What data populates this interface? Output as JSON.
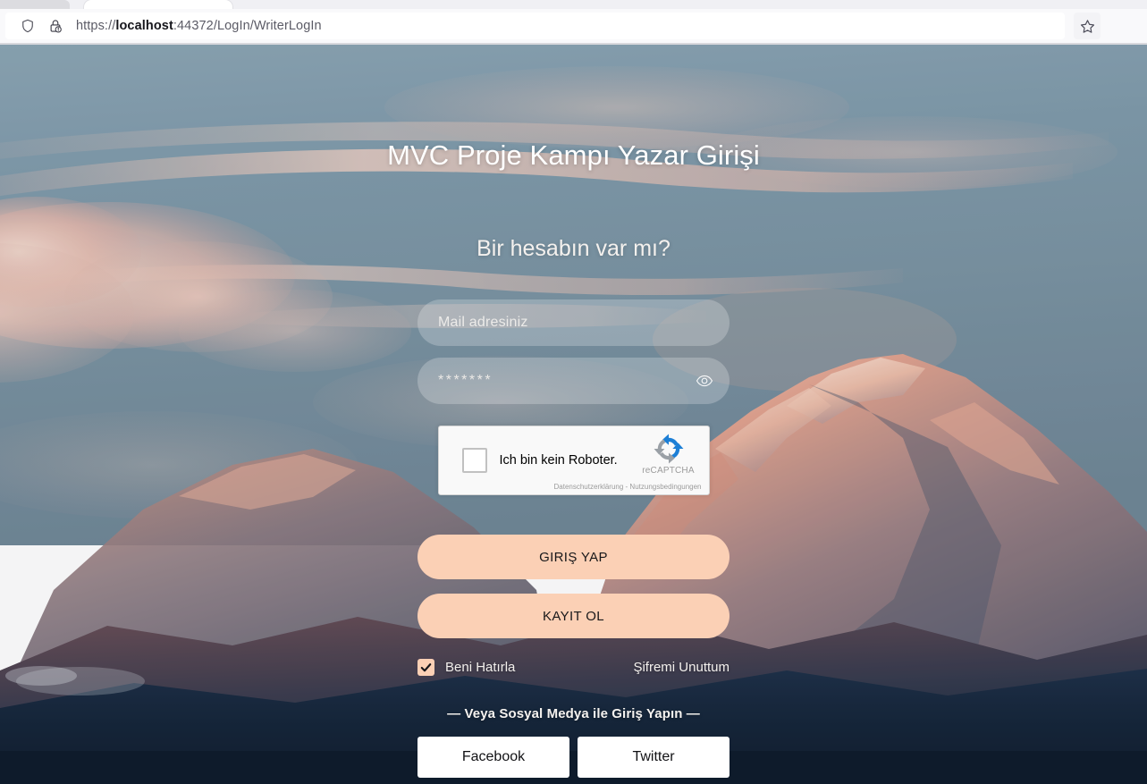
{
  "browser": {
    "url_prefix": "https://",
    "url_host": "localhost",
    "url_rest": ":44372/LogIn/WriterLogIn",
    "full_url": "https://localhost:44372/LogIn/WriterLogIn",
    "shield_icon": "shield-icon",
    "lock_icon": "lock-warning-icon",
    "bookmark_icon": "bookmark-star-icon"
  },
  "login": {
    "title": "MVC Proje Kampı Yazar Girişi",
    "subtitle": "Bir hesabın var mı?",
    "email_placeholder": "Mail adresiniz",
    "password_value": "*******",
    "password_toggle_icon": "eye-icon",
    "login_button": "GIRIŞ YAP",
    "register_button": "KAYIT OL",
    "remember_label": "Beni Hatırla",
    "remember_checked": true,
    "remember_check_glyph": "✔",
    "forgot_password": "Şifremi Unuttum",
    "social_divider": "— Veya Sosyal Medya ile Giriş Yapın —",
    "social_buttons": [
      {
        "label": "Facebook",
        "name": "facebook-login-button"
      },
      {
        "label": "Twitter",
        "name": "twitter-login-button"
      }
    ]
  },
  "recaptcha": {
    "label": "Ich bin kein Roboter.",
    "brand": "reCAPTCHA",
    "legal": "Datenschutzerklärung - Nutzungsbedingungen",
    "logo_icon": "recaptcha-logo-icon",
    "checked": false
  },
  "colors": {
    "accent_button": "#fbd0b5",
    "field_overlay": "rgba(255,255,255,0.23)",
    "sky": "#7e99a8",
    "cloud_pink": "#e6b6ab",
    "mountain_lit": "#e0a493",
    "foreground_dark": "#14253a",
    "chrome_bg": "#f9f9fb",
    "white": "#ffffff"
  }
}
